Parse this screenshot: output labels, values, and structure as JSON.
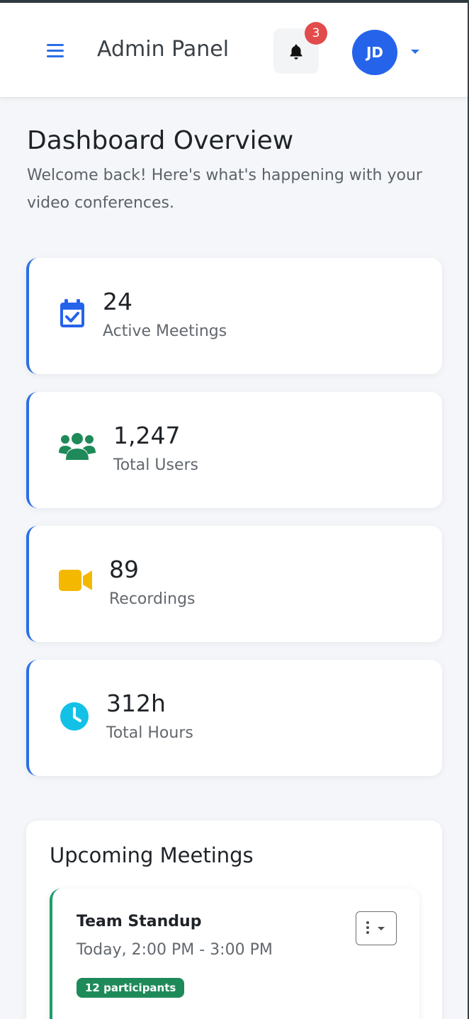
{
  "navbar": {
    "brand": "Admin Panel",
    "notification_count": "3",
    "avatar_initials": "JD",
    "icons": [
      "hamburger-menu-icon",
      "bell-icon",
      "chevron-down-icon"
    ],
    "accent_color": "#2563eb"
  },
  "header": {
    "title": "Dashboard Overview",
    "subtitle": "Welcome back! Here's what's happening with your video conferences."
  },
  "stats": [
    {
      "value": "24",
      "label": "Active Meetings",
      "icon": "calendar-check-icon",
      "color": "#2563eb"
    },
    {
      "value": "1,247",
      "label": "Total Users",
      "icon": "users-icon",
      "color": "#1f8a59"
    },
    {
      "value": "89",
      "label": "Recordings",
      "icon": "video-camera-icon",
      "color": "#f5b800"
    },
    {
      "value": "312h",
      "label": "Total Hours",
      "icon": "clock-icon",
      "color": "#13c1e6"
    }
  ],
  "upcoming": {
    "title": "Upcoming Meetings",
    "meetings": [
      {
        "name": "Team Standup",
        "time": "Today, 2:00 PM - 3:00 PM",
        "participants": "12 participants",
        "status_color": "#1f9d6a"
      }
    ]
  }
}
